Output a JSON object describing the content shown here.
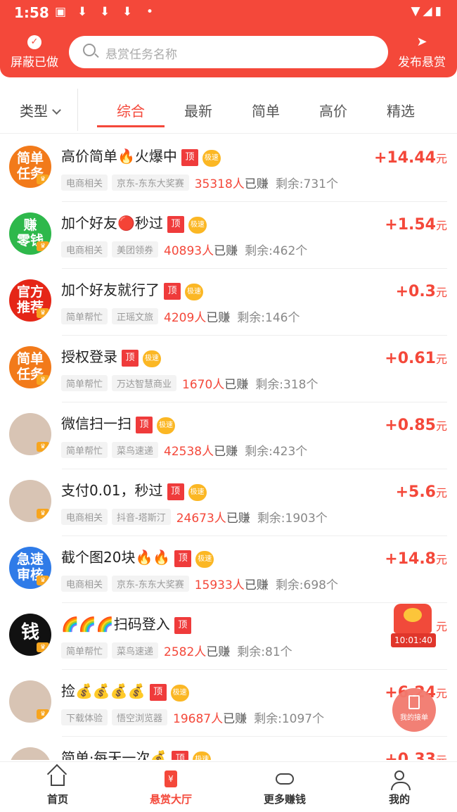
{
  "status_bar": {
    "time": "1:58",
    "dot": "•"
  },
  "header": {
    "hide_done_label": "屏蔽已做",
    "search_placeholder": "悬赏任务名称",
    "publish_label": "发布悬赏"
  },
  "filter": {
    "type_label": "类型"
  },
  "tabs": [
    {
      "label": "综合",
      "active": true
    },
    {
      "label": "最新"
    },
    {
      "label": "简单"
    },
    {
      "label": "高价"
    },
    {
      "label": "精选"
    }
  ],
  "badge_top": "顶",
  "badge_vip": "极速",
  "tasks": [
    {
      "avatar_text": [
        "简单",
        "任务"
      ],
      "avatar_color": "#f27a1a",
      "title": "高价简单🔥火爆中",
      "tags": [
        "电商相关",
        "京东-东东大奖赛"
      ],
      "earned_count": "35318人",
      "earned_suffix": "已赚",
      "remain": "剩余:731个",
      "reward": "+14.44",
      "unit": "元",
      "vip": true
    },
    {
      "avatar_text": [
        "赚",
        "零钱"
      ],
      "avatar_color": "#2eb84b",
      "title": "加个好友🔴秒过",
      "tags": [
        "电商相关",
        "美团领券"
      ],
      "earned_count": "40893人",
      "earned_suffix": "已赚",
      "remain": "剩余:462个",
      "reward": "+1.54",
      "unit": "元",
      "vip": true
    },
    {
      "avatar_text": [
        "官方",
        "推荐"
      ],
      "avatar_color": "#e52617",
      "title": "加个好友就行了",
      "tags": [
        "简单帮忙",
        "正瑶文旅"
      ],
      "earned_count": "4209人",
      "earned_suffix": "已赚",
      "remain": "剩余:146个",
      "reward": "+0.3",
      "unit": "元",
      "vip": true
    },
    {
      "avatar_text": [
        "简单",
        "任务"
      ],
      "avatar_color": "#f27a1a",
      "title": "授权登录",
      "tags": [
        "简单帮忙",
        "万达智慧商业"
      ],
      "earned_count": "1670人",
      "earned_suffix": "已赚",
      "remain": "剩余:318个",
      "reward": "+0.61",
      "unit": "元",
      "vip": true
    },
    {
      "avatar_text": [
        "",
        ""
      ],
      "avatar_color": "photo",
      "title": "微信扫一扫",
      "tags": [
        "简单帮忙",
        "菜鸟速递"
      ],
      "earned_count": "42538人",
      "earned_suffix": "已赚",
      "remain": "剩余:423个",
      "reward": "+0.85",
      "unit": "元",
      "vip": true
    },
    {
      "avatar_text": [
        "",
        ""
      ],
      "avatar_color": "photo",
      "title": "支付0.01，秒过",
      "tags": [
        "电商相关",
        "抖音-塔斯汀"
      ],
      "earned_count": "24673人",
      "earned_suffix": "已赚",
      "remain": "剩余:1903个",
      "reward": "+5.6",
      "unit": "元",
      "vip": true
    },
    {
      "avatar_text": [
        "急速",
        "审核"
      ],
      "avatar_color": "#2f7be8",
      "title": "截个图20块🔥🔥",
      "tags": [
        "电商相关",
        "京东-东东大奖赛"
      ],
      "earned_count": "15933人",
      "earned_suffix": "已赚",
      "remain": "剩余:698个",
      "reward": "+14.8",
      "unit": "元",
      "vip": true
    },
    {
      "avatar_text": [
        "钱",
        ""
      ],
      "avatar_color": "#111111",
      "title": "🌈🌈🌈扫码登入",
      "tags": [
        "简单帮忙",
        "菜鸟速递"
      ],
      "earned_count": "2582人",
      "earned_suffix": "已赚",
      "remain": "剩余:81个",
      "reward": "",
      "unit": "元",
      "vip": false
    },
    {
      "avatar_text": [
        "",
        ""
      ],
      "avatar_color": "photo",
      "title": "捡💰💰💰💰",
      "tags": [
        "下载体验",
        "悟空浏览器"
      ],
      "earned_count": "19687人",
      "earned_suffix": "已赚",
      "remain": "剩余:1097个",
      "reward": "+6.24",
      "unit": "元",
      "vip": true
    },
    {
      "avatar_text": [
        "",
        ""
      ],
      "avatar_color": "photo",
      "title": "简单·每天一次💰",
      "tags": [
        "",
        ""
      ],
      "earned_count": "",
      "earned_suffix": "",
      "remain": "",
      "reward": "+0.33",
      "unit": "元",
      "vip": true
    }
  ],
  "red_packet": {
    "timer": "10:01:40"
  },
  "my_orders_label": "我的接单",
  "bottom_nav": [
    {
      "label": "首页"
    },
    {
      "label": "悬赏大厅",
      "icon_text": "¥",
      "active": true
    },
    {
      "label": "更多赚钱"
    },
    {
      "label": "我的"
    }
  ]
}
